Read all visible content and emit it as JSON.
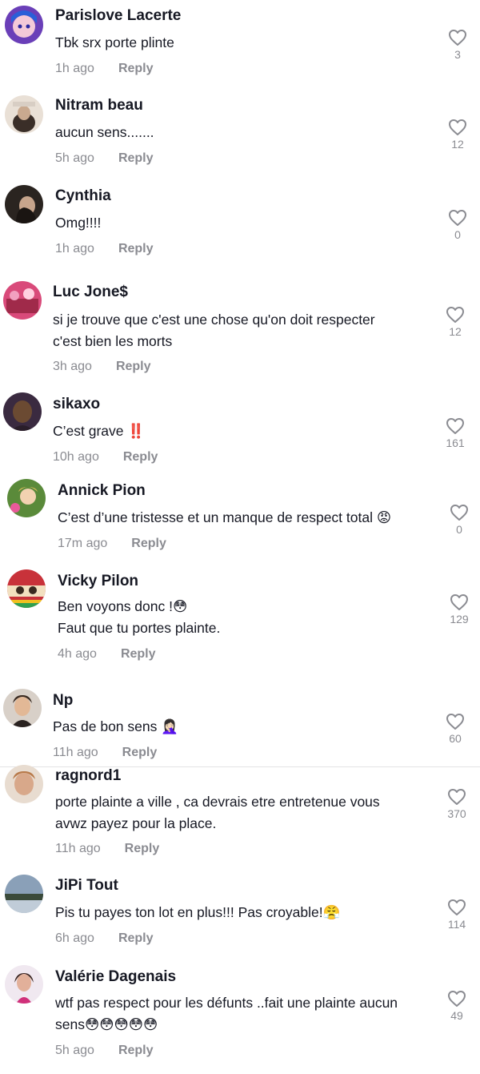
{
  "comments": [
    {
      "username": "Parislove Lacerte",
      "text": "Tbk srx porte plinte",
      "time": "1h ago",
      "reply": "Reply",
      "likes": "3",
      "avatar_icon": "avatar-anime-girl"
    },
    {
      "username": "Nitram beau",
      "text": "aucun sens.......",
      "time": "5h ago",
      "reply": "Reply",
      "likes": "12",
      "avatar_icon": "avatar-photo"
    },
    {
      "username": "Cynthia",
      "text": "Omg!!!!",
      "time": "1h ago",
      "reply": "Reply",
      "likes": "0",
      "avatar_icon": "avatar-photo"
    },
    {
      "username": "Luc Jone$",
      "text": "si je trouve que c'est une chose qu'on doit respecter\nc'est bien les morts",
      "time": "3h ago",
      "reply": "Reply",
      "likes": "12",
      "avatar_icon": "avatar-photo"
    },
    {
      "username": "sikaxo",
      "text": "C’est grave ‼️",
      "time": "10h ago",
      "reply": "Reply",
      "likes": "161",
      "avatar_icon": "avatar-photo"
    },
    {
      "username": "Annick Pion",
      "text": "C’est d’une tristesse et un manque de respect total 😡",
      "time": "17m ago",
      "reply": "Reply",
      "likes": "0",
      "avatar_icon": "avatar-photo"
    },
    {
      "username": "Vicky Pilon",
      "text": "Ben voyons donc !😳\nFaut que tu portes plainte.",
      "time": "4h ago",
      "reply": "Reply",
      "likes": "129",
      "avatar_icon": "avatar-photo"
    },
    {
      "username": "Np",
      "text": "Pas de bon sens 🤦🏻‍♀️",
      "time": "11h ago",
      "reply": "Reply",
      "likes": "60",
      "avatar_icon": "avatar-photo"
    },
    {
      "username": "ragnord1",
      "text": "porte plainte a ville , ca devrais etre entretenue vous\navwz payez pour la place.",
      "time": "11h ago",
      "reply": "Reply",
      "likes": "370",
      "avatar_icon": "avatar-photo"
    },
    {
      "username": "JiPi Tout",
      "text": "Pis tu payes ton lot en plus!!! Pas croyable!😤",
      "time": "6h ago",
      "reply": "Reply",
      "likes": "114",
      "avatar_icon": "avatar-photo"
    },
    {
      "username": "Valérie Dagenais",
      "text": "wtf pas respect pour les défunts ..fait une plainte aucun\nsens😳😳😳😳😳",
      "time": "5h ago",
      "reply": "Reply",
      "likes": "49",
      "avatar_icon": "avatar-photo"
    }
  ],
  "colors": {
    "username": "#161823",
    "meta": "#8a8b91",
    "heart_outline": "#8a8b91",
    "divider": "#e3e3e4"
  },
  "icons": {
    "like": "heart-outline-icon"
  }
}
